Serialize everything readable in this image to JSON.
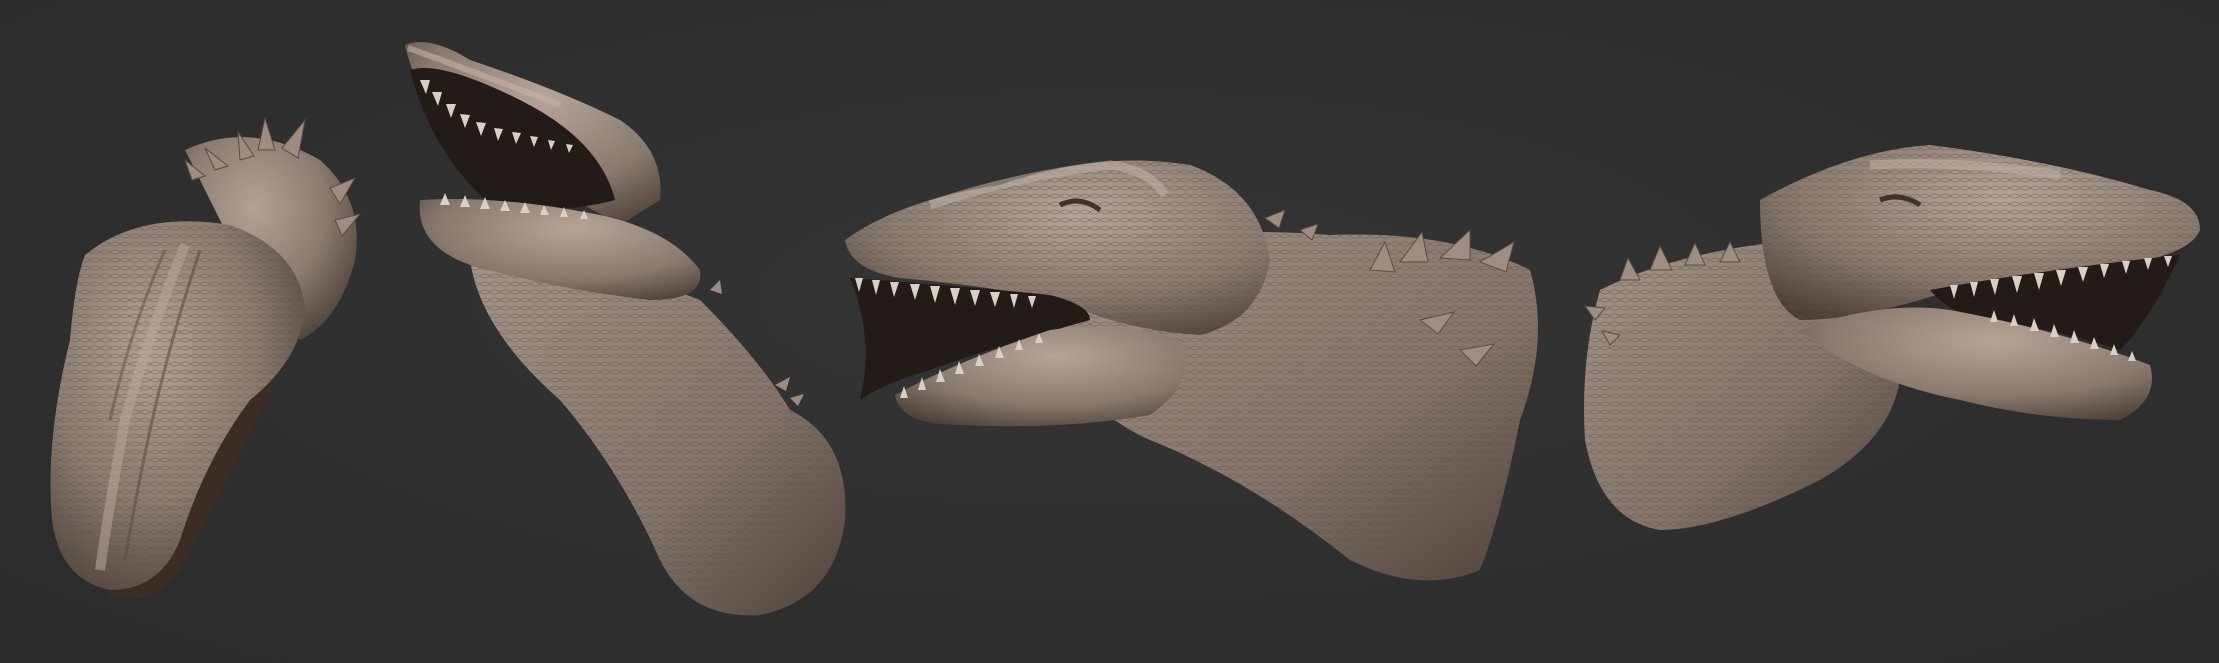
{
  "scene": {
    "background_color": "#2f2f2f",
    "clay_color": "#8c7c70",
    "clay_highlight": "#b3a294",
    "clay_shadow": "#4a3d35",
    "mouth_interior": "#231b18",
    "tooth_color": "#d9cfc4",
    "views": [
      {
        "id": "front-view",
        "subject": "dinosaur-head-sculpt"
      },
      {
        "id": "upward-view",
        "subject": "dinosaur-head-sculpt"
      },
      {
        "id": "left-profile-view",
        "subject": "dinosaur-head-sculpt"
      },
      {
        "id": "right-profile-view",
        "subject": "dinosaur-head-sculpt"
      }
    ]
  }
}
